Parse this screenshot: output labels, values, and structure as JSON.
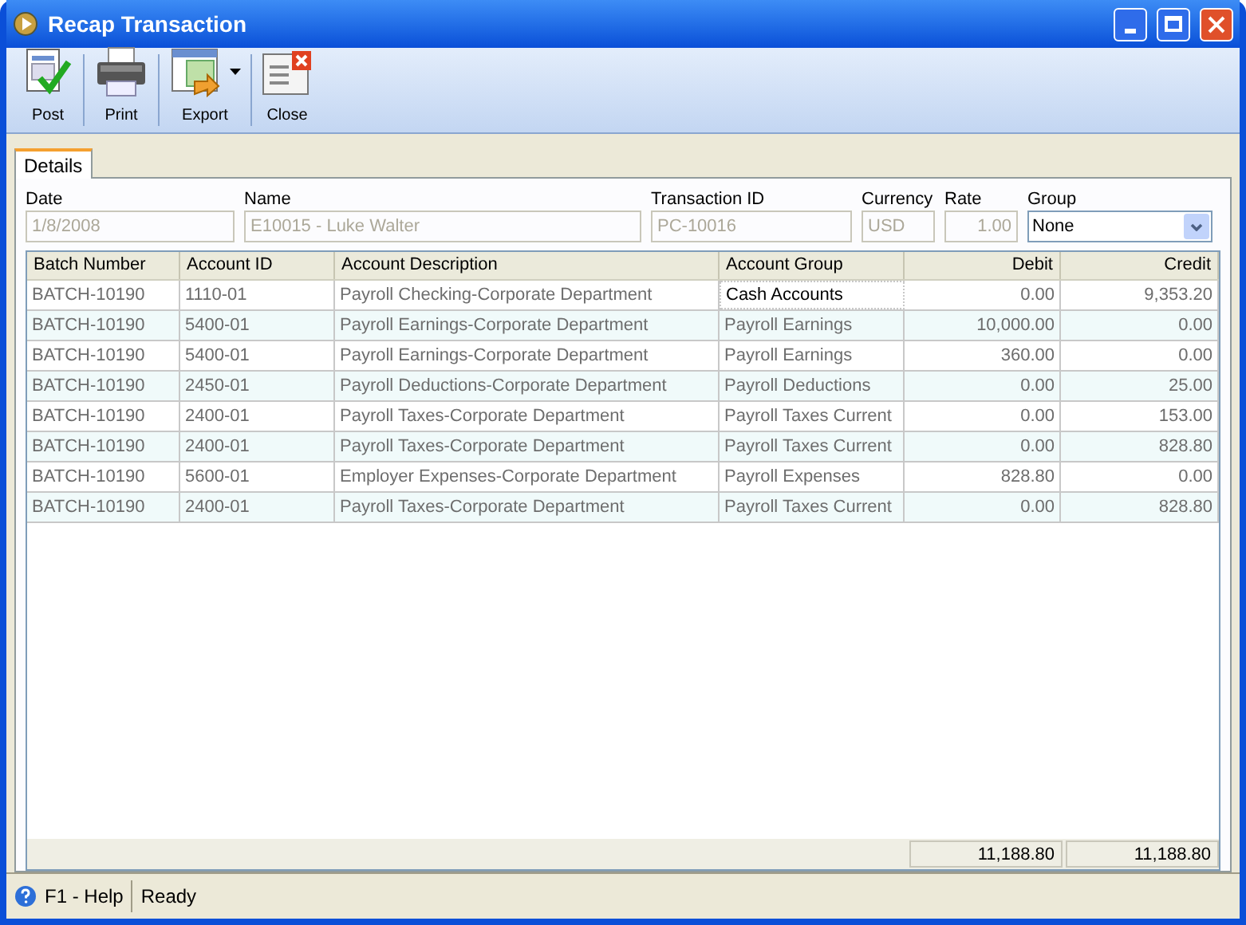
{
  "window": {
    "title": "Recap Transaction"
  },
  "toolbar": [
    {
      "label": "Post",
      "kind": "post",
      "dropdown": false
    },
    {
      "label": "Print",
      "kind": "print",
      "dropdown": false
    },
    {
      "label": "Export",
      "kind": "export",
      "dropdown": true
    },
    {
      "label": "Close",
      "kind": "close",
      "dropdown": false
    }
  ],
  "tabs": [
    {
      "label": "Details",
      "selected": true
    }
  ],
  "fields": [
    {
      "label": "Date",
      "value": "1/8/2008",
      "kind": "text",
      "disabled": true
    },
    {
      "label": "Name",
      "value": "E10015 - Luke Walter",
      "kind": "text",
      "disabled": true
    },
    {
      "label": "Transaction ID",
      "value": "PC-10016",
      "kind": "text",
      "disabled": true
    },
    {
      "label": "Currency",
      "value": "USD",
      "kind": "text",
      "disabled": true
    },
    {
      "label": "Rate",
      "value": "1.00",
      "kind": "number",
      "disabled": true
    },
    {
      "label": "Group",
      "value": "None",
      "kind": "select",
      "disabled": false
    }
  ],
  "table": {
    "columns": [
      "Batch Number",
      "Account ID",
      "Account Description",
      "Account Group",
      "Debit",
      "Credit"
    ],
    "rows": [
      {
        "cells": [
          "BATCH-10190",
          "1110-01",
          "Payroll Checking-Corporate Department",
          "Cash Accounts",
          "0.00",
          "9,353.20"
        ],
        "selected": true
      },
      {
        "cells": [
          "BATCH-10190",
          "5400-01",
          "Payroll Earnings-Corporate Department",
          "Payroll Earnings",
          "10,000.00",
          "0.00"
        ],
        "selected": false
      },
      {
        "cells": [
          "BATCH-10190",
          "5400-01",
          "Payroll Earnings-Corporate Department",
          "Payroll Earnings",
          "360.00",
          "0.00"
        ],
        "selected": false
      },
      {
        "cells": [
          "BATCH-10190",
          "2450-01",
          "Payroll Deductions-Corporate Department",
          "Payroll Deductions",
          "0.00",
          "25.00"
        ],
        "selected": false
      },
      {
        "cells": [
          "BATCH-10190",
          "2400-01",
          "Payroll Taxes-Corporate Department",
          "Payroll Taxes Current",
          "0.00",
          "153.00"
        ],
        "selected": false
      },
      {
        "cells": [
          "BATCH-10190",
          "2400-01",
          "Payroll Taxes-Corporate Department",
          "Payroll Taxes Current",
          "0.00",
          "828.80"
        ],
        "selected": false
      },
      {
        "cells": [
          "BATCH-10190",
          "5600-01",
          "Employer Expenses-Corporate Department",
          "Payroll Expenses",
          "828.80",
          "0.00"
        ],
        "selected": false
      },
      {
        "cells": [
          "BATCH-10190",
          "2400-01",
          "Payroll Taxes-Corporate Department",
          "Payroll Taxes Current",
          "0.00",
          "828.80"
        ],
        "selected": false
      }
    ],
    "totals": {
      "debit": "11,188.80",
      "credit": "11,188.80"
    }
  },
  "status_bar": {
    "help": "F1 - Help",
    "status": "Ready"
  }
}
